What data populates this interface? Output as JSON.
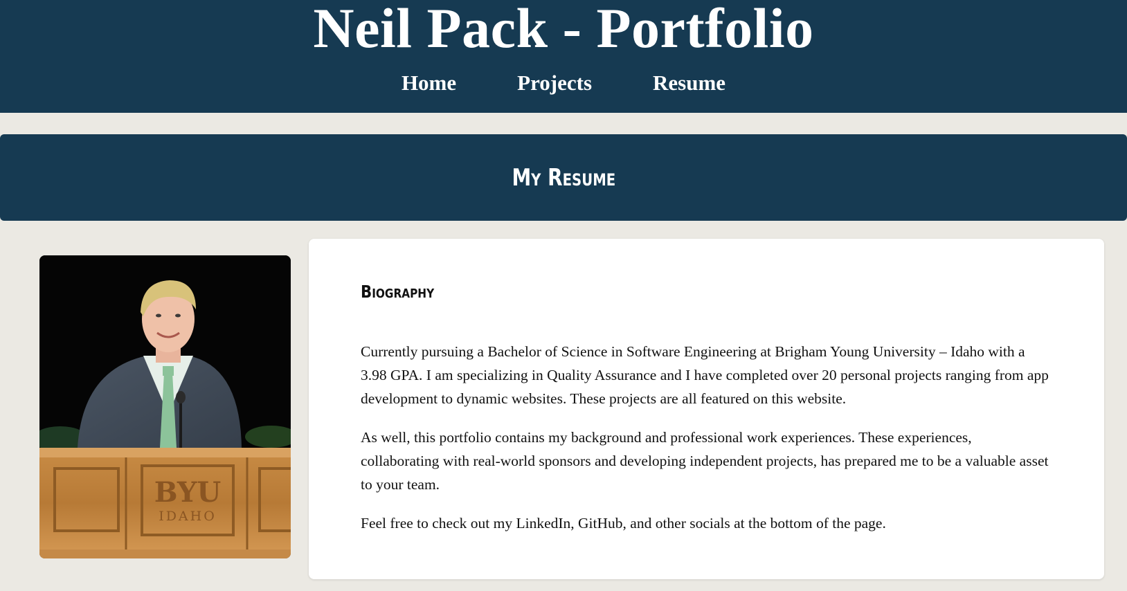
{
  "header": {
    "title": "Neil Pack - Portfolio",
    "nav": [
      "Home",
      "Projects",
      "Resume"
    ]
  },
  "banner": {
    "title": "My Resume"
  },
  "photo": {
    "alt": "Portrait of Neil Pack at a BYU-Idaho podium",
    "podium_text": "BYU",
    "podium_subtext": "IDAHO"
  },
  "biography": {
    "heading": "Biography",
    "paragraphs": [
      "Currently pursuing a Bachelor of Science in Software Engineering at Brigham Young University – Idaho with a 3.98 GPA. I am specializing in Quality Assurance and I have completed over 20 personal projects ranging from app development to dynamic websites. These projects are all featured on this website.",
      "As well, this portfolio contains my background and professional work experiences. These experiences, collaborating with real-world sponsors and developing independent projects, has prepared me to be a valuable asset to your team.",
      "Feel free to check out my LinkedIn, GitHub, and other socials at the bottom of the page."
    ]
  },
  "colors": {
    "header_bg": "#163a52",
    "page_bg": "#ebe9e3",
    "card_bg": "#ffffff"
  }
}
